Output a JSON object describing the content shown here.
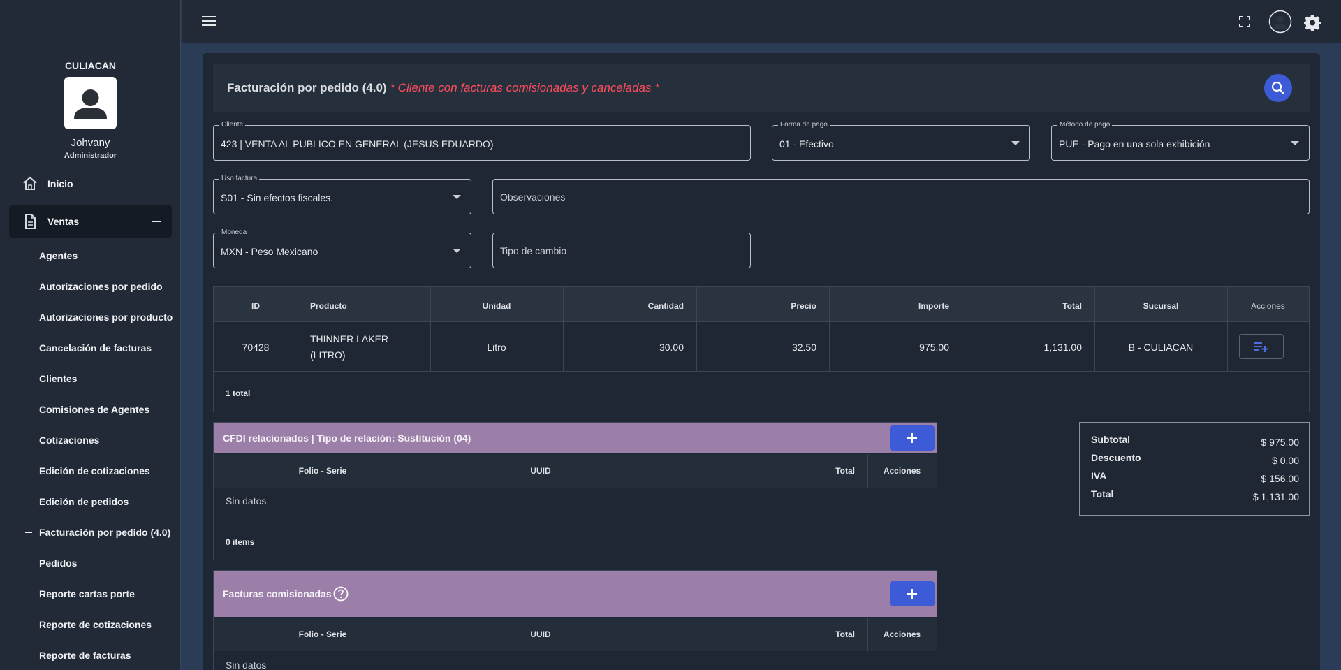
{
  "sidebar": {
    "branch": "CULIACAN",
    "user_name": "Johvany",
    "user_role": "Administrador",
    "inicio": "Inicio",
    "ventas": "Ventas",
    "items": [
      "Agentes",
      "Autorizaciones por pedido",
      "Autorizaciones por producto",
      "Cancelación de facturas",
      "Clientes",
      "Comisiones de Agentes",
      "Cotizaciones",
      "Edición de cotizaciones",
      "Edición de pedidos",
      "Facturación por pedido (4.0)",
      "Pedidos",
      "Reporte cartas porte",
      "Reporte de cotizaciones",
      "Reporte de facturas"
    ]
  },
  "page": {
    "title": "Facturación por pedido (4.0)",
    "warning": "* Cliente con facturas comisionadas y canceladas *"
  },
  "form": {
    "cliente_label": "Cliente",
    "cliente_value": "423 | VENTA AL PUBLICO EN GENERAL (JESUS EDUARDO)",
    "forma_label": "Forma de pago",
    "forma_value": "01 - Efectivo",
    "metodo_label": "Método de pago",
    "metodo_value": "PUE - Pago en una sola exhibición",
    "uso_label": "Uso factura",
    "uso_value": "S01 - Sin efectos fiscales.",
    "observaciones_placeholder": "Observaciones",
    "moneda_label": "Moneda",
    "moneda_value": "MXN - Peso Mexicano",
    "tipo_cambio_placeholder": "Tipo de cambio"
  },
  "products": {
    "headers": [
      "ID",
      "Producto",
      "Unidad",
      "Cantidad",
      "Precio",
      "Importe",
      "Total",
      "Sucursal",
      "Acciones"
    ],
    "row": {
      "id": "70428",
      "producto_l1": "THINNER LAKER",
      "producto_l2": "(LITRO)",
      "unidad": "Litro",
      "cantidad": "30.00",
      "precio": "32.50",
      "importe": "975.00",
      "total": "1,131.00",
      "sucursal": "B - CULIACAN"
    },
    "footer": "1 total"
  },
  "cfdi": {
    "title": "CFDI relacionados | Tipo de relación: Sustitución (04)",
    "cols": [
      "Folio - Serie",
      "UUID",
      "Total",
      "Acciones"
    ],
    "empty": "Sin datos",
    "count": "0 items"
  },
  "comisionadas": {
    "title": "Facturas comisionadas",
    "cols": [
      "Folio - Serie",
      "UUID",
      "Total",
      "Acciones"
    ],
    "empty": "Sin datos"
  },
  "totals": {
    "subtotal_label": "Subtotal",
    "subtotal": "$ 975.00",
    "descuento_label": "Descuento",
    "descuento": "$ 0.00",
    "iva_label": "IVA",
    "iva": "$ 156.00",
    "total_label": "Total",
    "total": "$ 1,131.00"
  },
  "colors": {
    "accent": "#3d5bd6",
    "panel_header": "#9c7fa9",
    "warning": "#ff4d5e"
  }
}
